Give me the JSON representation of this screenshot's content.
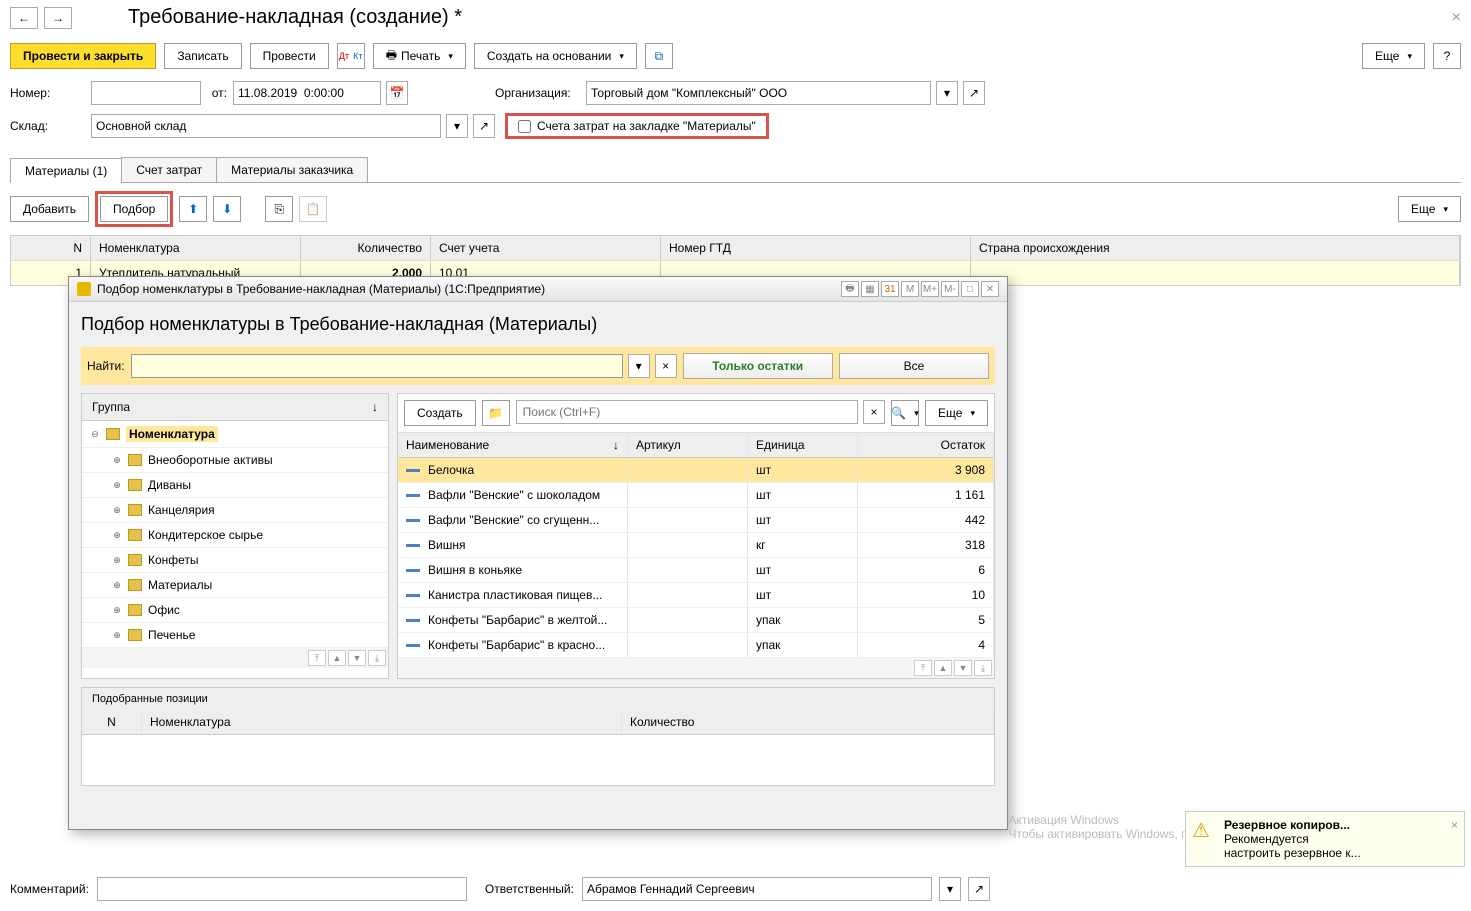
{
  "header": {
    "title": "Требование-накладная (создание) *"
  },
  "toolbar": {
    "post_close": "Провести и закрыть",
    "save": "Записать",
    "post": "Провести",
    "print": "Печать",
    "create_based": "Создать на основании",
    "more": "Еще",
    "help": "?"
  },
  "form": {
    "number_label": "Номер:",
    "from_label": "от:",
    "date_value": "11.08.2019  0:00:00",
    "org_label": "Организация:",
    "org_value": "Торговый дом \"Комплексный\" ООО",
    "warehouse_label": "Склад:",
    "warehouse_value": "Основной склад",
    "cost_checkbox_label": "Счета затрат на закладке \"Материалы\""
  },
  "tabs": {
    "materials": "Материалы (1)",
    "cost_account": "Счет затрат",
    "customer_materials": "Материалы заказчика"
  },
  "subtoolbar": {
    "add": "Добавить",
    "select": "Подбор",
    "more": "Еще"
  },
  "grid_headers": {
    "n": "N",
    "nomenclature": "Номенклатура",
    "qty": "Количество",
    "account": "Счет учета",
    "gtd": "Номер ГТД",
    "country": "Страна происхождения"
  },
  "grid_rows": [
    {
      "n": "1",
      "nomenclature": "Утеплитель натуральный",
      "qty": "2,000",
      "account": "10.01",
      "gtd": "",
      "country": ""
    }
  ],
  "modal": {
    "window_title": "Подбор номенклатуры в Требование-накладная (Материалы)  (1С:Предприятие)",
    "title": "Подбор номенклатуры в Требование-накладная (Материалы)",
    "find_label": "Найти:",
    "only_balance": "Только остатки",
    "all": "Все",
    "group_header": "Группа",
    "tree": [
      {
        "level": 0,
        "name": "Номенклатура",
        "open": true,
        "selected": true
      },
      {
        "level": 1,
        "name": "Внеоборотные активы"
      },
      {
        "level": 1,
        "name": "Диваны"
      },
      {
        "level": 1,
        "name": "Канцелярия"
      },
      {
        "level": 1,
        "name": "Кондитерское сырье"
      },
      {
        "level": 1,
        "name": "Конфеты"
      },
      {
        "level": 1,
        "name": "Материалы"
      },
      {
        "level": 1,
        "name": "Офис"
      },
      {
        "level": 1,
        "name": "Печенье"
      }
    ],
    "right_toolbar": {
      "create": "Создать",
      "search_placeholder": "Поиск (Ctrl+F)",
      "more": "Еще"
    },
    "right_headers": {
      "name": "Наименование",
      "article": "Артикул",
      "unit": "Единица",
      "stock": "Остаток"
    },
    "items": [
      {
        "name": "Белочка",
        "article": "",
        "unit": "шт",
        "stock": "3 908",
        "selected": true
      },
      {
        "name": "Вафли \"Венские\" с шоколадом",
        "article": "",
        "unit": "шт",
        "stock": "1 161"
      },
      {
        "name": "Вафли \"Венские\" со сгущенн...",
        "article": "",
        "unit": "шт",
        "stock": "442"
      },
      {
        "name": "Вишня",
        "article": "",
        "unit": "кг",
        "stock": "318"
      },
      {
        "name": "Вишня в коньяке",
        "article": "",
        "unit": "шт",
        "stock": "6"
      },
      {
        "name": "Канистра пластиковая пищев...",
        "article": "",
        "unit": "шт",
        "stock": "10"
      },
      {
        "name": "Конфеты \"Барбарис\" в желтой...",
        "article": "",
        "unit": "упак",
        "stock": "5"
      },
      {
        "name": "Конфеты \"Барбарис\" в красно...",
        "article": "",
        "unit": "упак",
        "stock": "4"
      }
    ],
    "selected_title": "Подобранные позиции",
    "selected_headers": {
      "n": "N",
      "nomenclature": "Номенклатура",
      "qty": "Количество"
    }
  },
  "footer": {
    "comment_label": "Комментарий:",
    "responsible_label": "Ответственный:",
    "responsible_value": "Абрамов Геннадий Сергеевич"
  },
  "watermark": {
    "title": "Активация Windows",
    "sub": "Чтобы активировать Windows, перейдите в раздел \"Параметры\"."
  },
  "toast": {
    "title": "Резервное копиров...",
    "line1": "Рекомендуется",
    "line2": "настроить резервное к..."
  },
  "wctrl": {
    "m": "M",
    "mplus": "M+",
    "mminus": "M-"
  }
}
